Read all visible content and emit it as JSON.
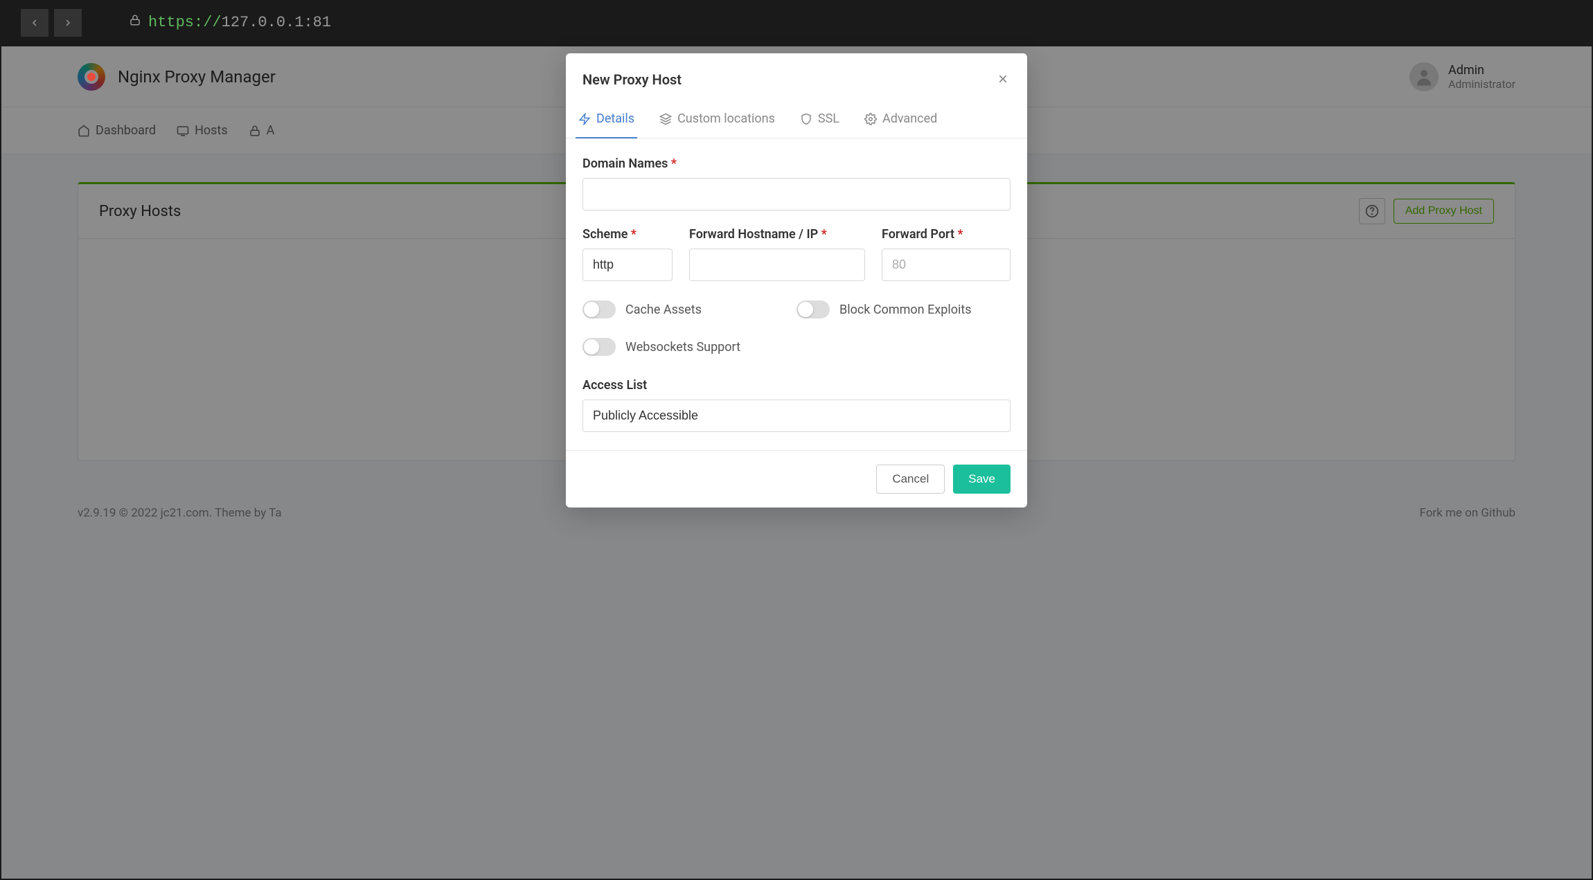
{
  "url": {
    "scheme": "https://",
    "host": "127.0.0.1:81"
  },
  "header": {
    "brand": "Nginx Proxy Manager",
    "user_name": "Admin",
    "user_role": "Administrator"
  },
  "nav": {
    "dashboard": "Dashboard",
    "hosts": "Hosts",
    "access": "A"
  },
  "page": {
    "title": "Proxy Hosts",
    "add_button": "Add Proxy Host"
  },
  "footer": {
    "left_version": "v2.9.19",
    "left_copy": " © 2022 ",
    "left_link": "jc21.com",
    "left_theme": ". Theme by Ta",
    "right": "Fork me on Github"
  },
  "modal": {
    "title": "New Proxy Host",
    "tabs": {
      "details": "Details",
      "custom": "Custom locations",
      "ssl": "SSL",
      "advanced": "Advanced"
    },
    "form": {
      "domain_label": "Domain Names",
      "scheme_label": "Scheme",
      "scheme_value": "http",
      "host_label": "Forward Hostname / IP",
      "host_value": "",
      "port_label": "Forward Port",
      "port_placeholder": "80",
      "port_value": "",
      "cache_label": "Cache Assets",
      "block_label": "Block Common Exploits",
      "ws_label": "Websockets Support",
      "access_label": "Access List",
      "access_value": "Publicly Accessible"
    },
    "buttons": {
      "cancel": "Cancel",
      "save": "Save"
    }
  }
}
